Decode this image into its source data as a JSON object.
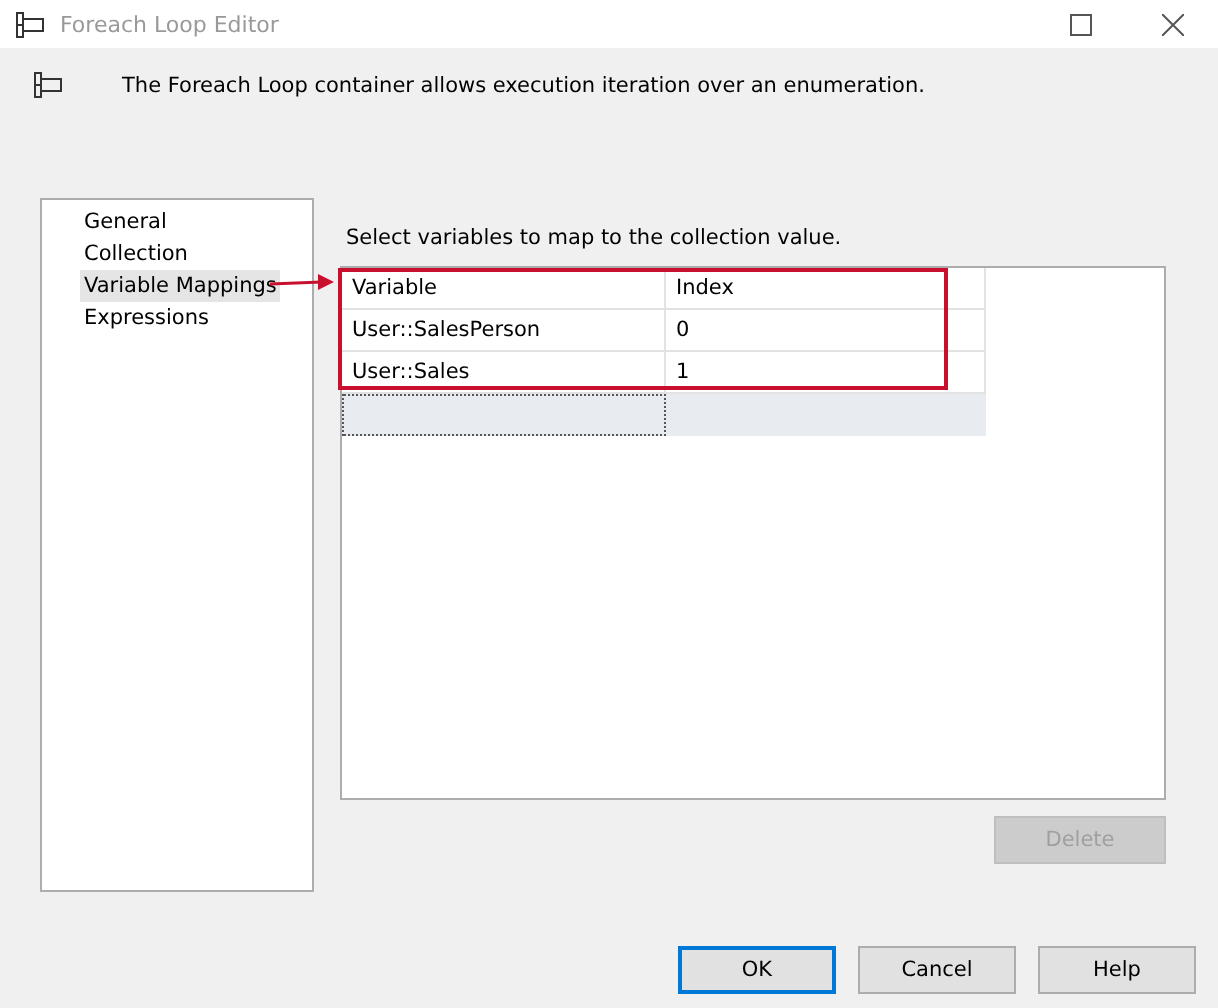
{
  "window": {
    "title": "Foreach Loop Editor"
  },
  "header": {
    "description": "The Foreach Loop container allows execution iteration over an enumeration."
  },
  "nav": {
    "items": [
      {
        "label": "General",
        "selected": false
      },
      {
        "label": "Collection",
        "selected": false
      },
      {
        "label": "Variable Mappings",
        "selected": true
      },
      {
        "label": "Expressions",
        "selected": false
      }
    ]
  },
  "mapping": {
    "instruction": "Select variables to map to the collection value.",
    "columns": [
      "Variable",
      "Index"
    ],
    "rows": [
      {
        "variable": "User::SalesPerson",
        "index": "0"
      },
      {
        "variable": "User::Sales",
        "index": "1"
      }
    ],
    "delete_button": {
      "label": "Delete",
      "disabled": true
    }
  },
  "buttons": [
    {
      "label": "OK",
      "selected": true
    },
    {
      "label": "Cancel",
      "selected": false
    },
    {
      "label": "Help",
      "selected": false
    }
  ]
}
